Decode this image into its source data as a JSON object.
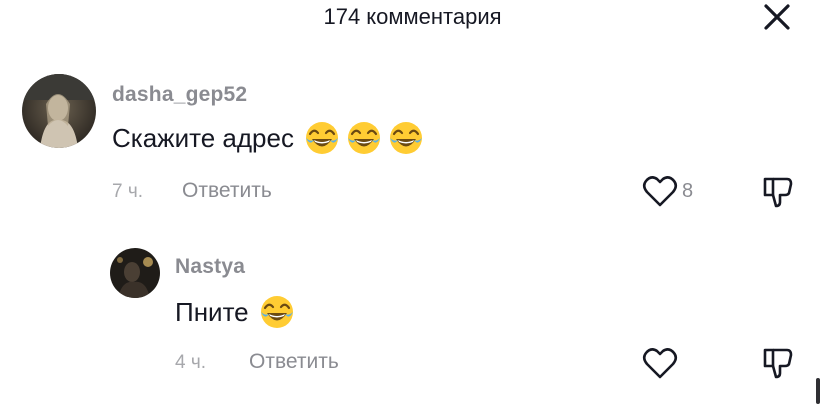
{
  "header": {
    "title": "174 комментария",
    "close_icon": "close-icon"
  },
  "comments": [
    {
      "username": "dasha_gep52",
      "text": "Скажите адрес",
      "emojis": [
        "face-with-tears-of-joy",
        "face-with-tears-of-joy",
        "face-with-tears-of-joy"
      ],
      "time": "7 ч.",
      "reply_label": "Ответить",
      "likes": "8",
      "like_icon": "heart-outline-icon",
      "dislike_icon": "thumbs-down-icon"
    },
    {
      "username": "Nastya",
      "text": "Пните",
      "emojis": [
        "face-with-tears-of-joy"
      ],
      "time": "4 ч.",
      "reply_label": "Ответить",
      "like_icon": "heart-outline-icon",
      "dislike_icon": "thumbs-down-icon"
    }
  ],
  "colors": {
    "primary_text": "#161823",
    "secondary_text": "#8a8b91",
    "muted_text": "#a7a8ac"
  }
}
